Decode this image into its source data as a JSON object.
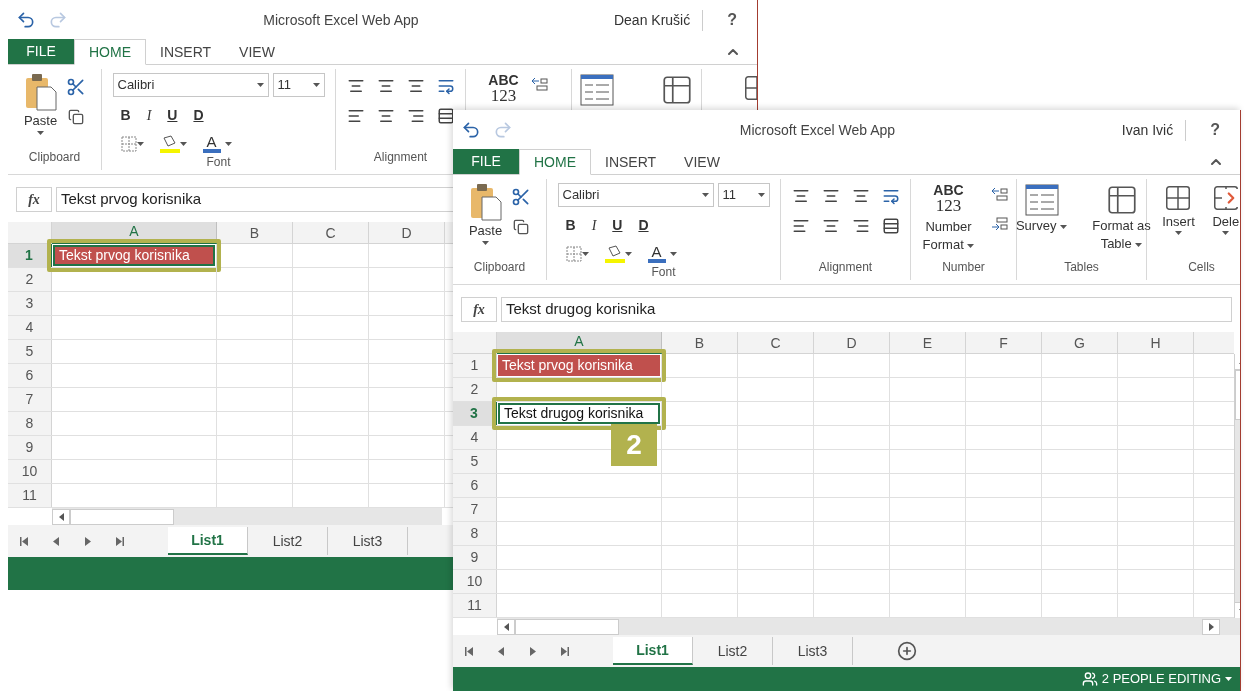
{
  "windows": [
    {
      "title": "Microsoft Excel Web App",
      "user": "Dean Krušić",
      "help": "?",
      "tabs": [
        {
          "label": "FILE",
          "kind": "file",
          "selected": false
        },
        {
          "label": "HOME",
          "kind": "tab",
          "selected": true
        },
        {
          "label": "INSERT",
          "kind": "tab",
          "selected": false
        },
        {
          "label": "VIEW",
          "kind": "tab",
          "selected": false
        }
      ],
      "groups": [
        {
          "kind": "clipboard",
          "label": "Clipboard",
          "paste": "Paste"
        },
        {
          "kind": "font",
          "label": "Font",
          "font_name": "Calibri",
          "font_size": "11",
          "styles": [
            "B",
            "I",
            "U",
            "D"
          ],
          "color_letter": "A"
        },
        {
          "kind": "alignment",
          "label": "Alignment"
        },
        {
          "kind": "number",
          "abc": "ABC",
          "digits": "123",
          "decimals": [
            {
              "kind": "decrease"
            }
          ]
        },
        {
          "kind": "tables"
        },
        {
          "kind": "cells"
        }
      ],
      "formula_label": "fx",
      "formula_text": "Tekst prvog korisnika",
      "columns": [
        {
          "label": "A",
          "selected": true
        },
        {
          "label": "B",
          "selected": false
        },
        {
          "label": "C",
          "selected": false
        },
        {
          "label": "D",
          "selected": false
        }
      ],
      "rows": [
        {
          "label": "1",
          "selected": true,
          "cells": [
            {
              "text": "Tekst prvog korisnika",
              "kind": "filled",
              "selected": true,
              "highlighted": true
            }
          ]
        },
        {
          "label": "2",
          "selected": false
        },
        {
          "label": "3",
          "selected": false
        },
        {
          "label": "4",
          "selected": false
        },
        {
          "label": "5",
          "selected": false
        },
        {
          "label": "6",
          "selected": false
        },
        {
          "label": "7",
          "selected": false
        },
        {
          "label": "8",
          "selected": false
        },
        {
          "label": "9",
          "selected": false
        },
        {
          "label": "10",
          "selected": false
        },
        {
          "label": "11",
          "selected": false
        }
      ],
      "sheets": [
        {
          "label": "List1",
          "selected": true
        },
        {
          "label": "List2",
          "selected": false
        },
        {
          "label": "List3",
          "selected": false
        }
      ]
    },
    {
      "title": "Microsoft Excel Web App",
      "user": "Ivan Ivić",
      "help": "?",
      "tabs": [
        {
          "label": "FILE",
          "kind": "file",
          "selected": false
        },
        {
          "label": "HOME",
          "kind": "tab",
          "selected": true
        },
        {
          "label": "INSERT",
          "kind": "tab",
          "selected": false
        },
        {
          "label": "VIEW",
          "kind": "tab",
          "selected": false
        }
      ],
      "groups": [
        {
          "kind": "clipboard",
          "label": "Clipboard",
          "paste": "Paste"
        },
        {
          "kind": "font",
          "label": "Font",
          "font_name": "Calibri",
          "font_size": "11",
          "styles": [
            "B",
            "I",
            "U",
            "D"
          ],
          "color_letter": "A"
        },
        {
          "kind": "alignment",
          "label": "Alignment"
        },
        {
          "kind": "number",
          "label": "Number",
          "abc": "ABC",
          "digits": "123",
          "buttons": [
            "Number Format"
          ],
          "decimals": [
            {
              "kind": "decrease"
            },
            {
              "kind": "increase"
            }
          ]
        },
        {
          "kind": "tables",
          "label": "Tables",
          "buttons": [
            "Survey",
            "Format as Table"
          ]
        },
        {
          "kind": "cells",
          "label": "Cells",
          "buttons": [
            "Insert",
            "Dele"
          ]
        }
      ],
      "ribbon_scroll": true,
      "formula_label": "fx",
      "formula_text": "Tekst drugog korisnika",
      "columns": [
        {
          "label": "A",
          "selected": true
        },
        {
          "label": "B",
          "selected": false
        },
        {
          "label": "C",
          "selected": false
        },
        {
          "label": "D",
          "selected": false
        },
        {
          "label": "E",
          "selected": false
        },
        {
          "label": "F",
          "selected": false
        },
        {
          "label": "G",
          "selected": false
        },
        {
          "label": "H",
          "selected": false
        }
      ],
      "rows": [
        {
          "label": "1",
          "selected": false,
          "cells": [
            {
              "text": "Tekst prvog korisnika",
              "kind": "filled",
              "selected": false,
              "highlighted": true
            }
          ]
        },
        {
          "label": "2",
          "selected": false
        },
        {
          "label": "3",
          "selected": true,
          "cells": [
            {
              "text": "Tekst drugog korisnika",
              "kind": "plain",
              "selected": true,
              "highlighted": true,
              "badge": "2"
            }
          ]
        },
        {
          "label": "4",
          "selected": false
        },
        {
          "label": "5",
          "selected": false
        },
        {
          "label": "6",
          "selected": false
        },
        {
          "label": "7",
          "selected": false
        },
        {
          "label": "8",
          "selected": false
        },
        {
          "label": "9",
          "selected": false
        },
        {
          "label": "10",
          "selected": false
        },
        {
          "label": "11",
          "selected": false
        }
      ],
      "vscroll": true,
      "sheets": [
        {
          "label": "List1",
          "selected": true
        },
        {
          "label": "List2",
          "selected": false
        },
        {
          "label": "List3",
          "selected": false
        }
      ],
      "add_sheet": true,
      "status": "2 PEOPLE EDITING"
    }
  ]
}
